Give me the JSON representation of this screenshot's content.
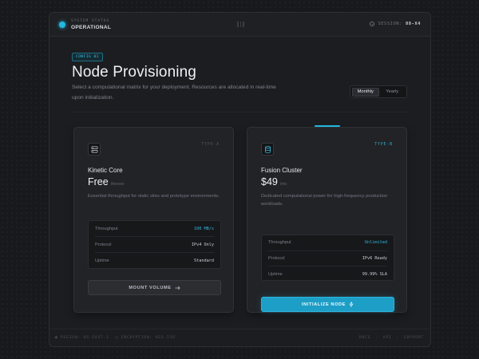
{
  "header": {
    "status_label": "SYSTEM STATUS",
    "status_value": "OPERATIONAL",
    "session_label": "SESSION:",
    "session_id": "88-X4"
  },
  "hero": {
    "tag": "CONFIG 01",
    "title": "Node Provisioning",
    "subtitle": "Select a computational matrix for your deployment. Resources are allocated in real-time upon initialization."
  },
  "billing_toggle": {
    "options": [
      "Monthly",
      "Yearly"
    ],
    "selected": "Monthly"
  },
  "plans": [
    {
      "type": "TYPE-A",
      "name": "Kinetic Core",
      "price": "Free",
      "period": "/forever",
      "description": "Essential throughput for static sites and prototype environments.",
      "specs": [
        {
          "label": "Throughput",
          "value": "100 MB/s"
        },
        {
          "label": "Protocol",
          "value": "IPv4 Only"
        },
        {
          "label": "Uptime",
          "value": "Standard"
        }
      ],
      "button": "MOUNT VOLUME",
      "button_icon": "arrow-right-icon"
    },
    {
      "type": "TYPE-B",
      "name": "Fusion Cluster",
      "price": "$49",
      "period": "/mo",
      "description": "Dedicated computational power for high-frequency production workloads.",
      "specs": [
        {
          "label": "Throughput",
          "value": "Unlimited"
        },
        {
          "label": "Protocol",
          "value": "IPv6 Ready"
        },
        {
          "label": "Uptime",
          "value": "99.99% SLA"
        }
      ],
      "button": "INITIALIZE NODE",
      "button_icon": "bolt-icon"
    }
  ],
  "footer": {
    "region": "● REGION: US-EAST-1",
    "encryption": "◎ ENCRYPTION: AES-256",
    "links": [
      "DOCS",
      "API",
      "SUPPORT"
    ]
  },
  "colors": {
    "accent": "#23b7e0",
    "background": "#18191c",
    "card": "#222327"
  }
}
